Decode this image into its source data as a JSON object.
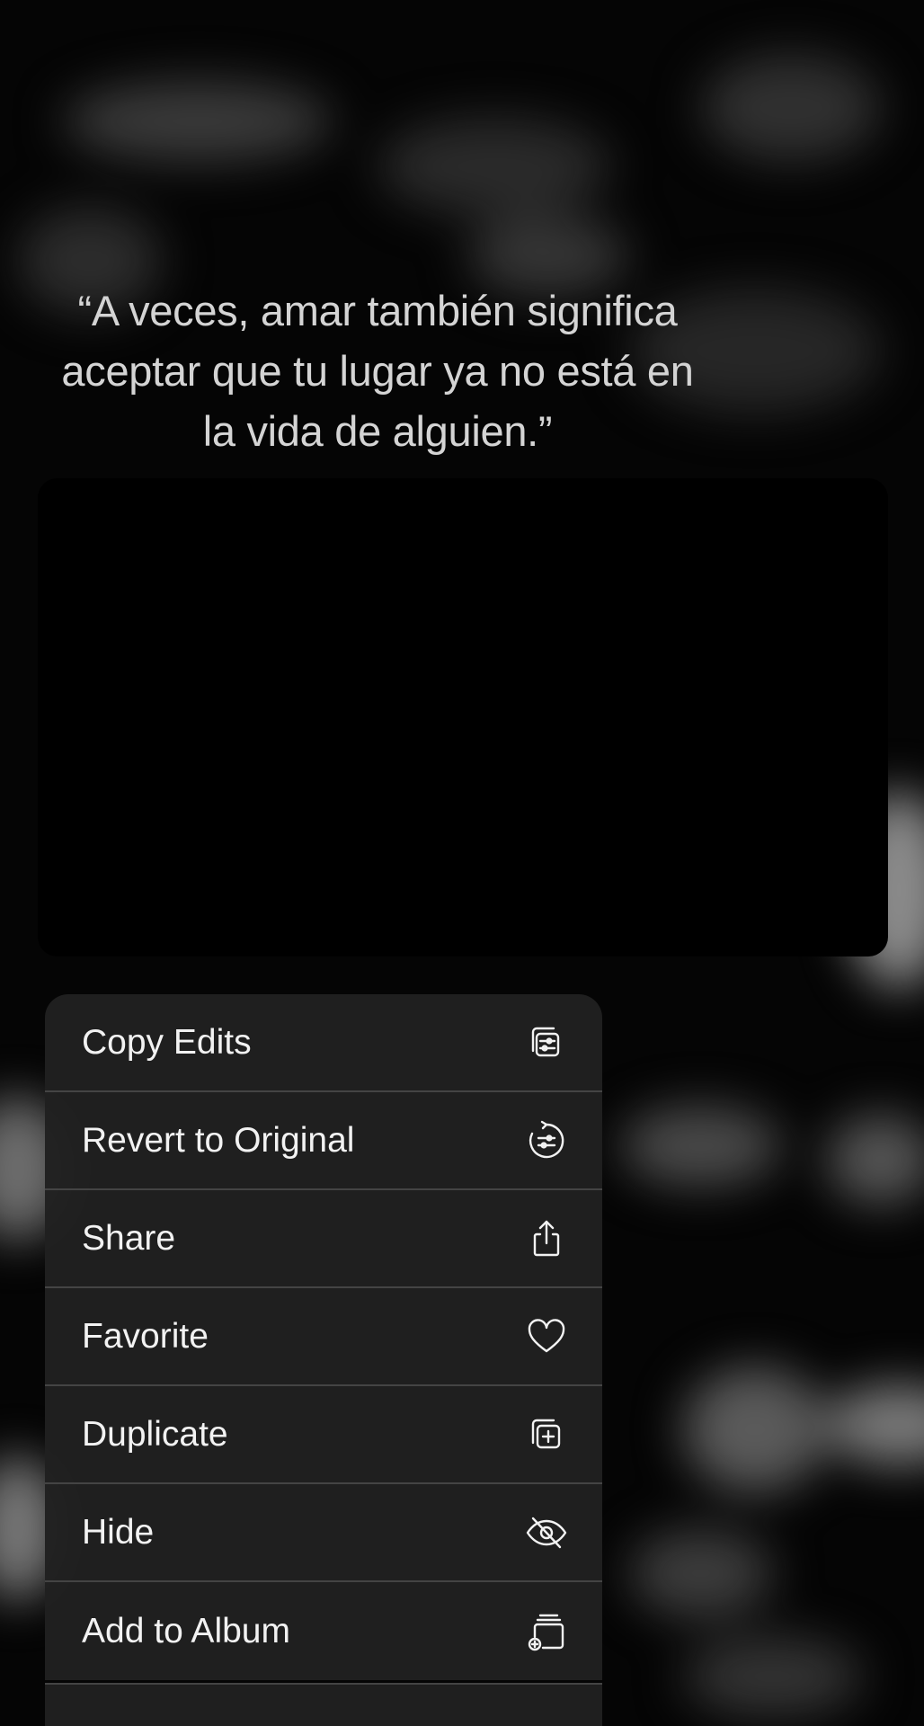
{
  "quote": {
    "line1": "“A veces, amar también significa",
    "line2": "aceptar que tu lugar ya no está en",
    "line3": "la vida de alguien.”"
  },
  "menu": {
    "items": [
      {
        "label": "Copy Edits",
        "icon": "copy-edits-icon"
      },
      {
        "label": "Revert to Original",
        "icon": "revert-icon"
      },
      {
        "label": "Share",
        "icon": "share-icon"
      },
      {
        "label": "Favorite",
        "icon": "heart-icon"
      },
      {
        "label": "Duplicate",
        "icon": "duplicate-icon"
      },
      {
        "label": "Hide",
        "icon": "eye-slash-icon"
      },
      {
        "label": "Add to Album",
        "icon": "add-to-album-icon"
      }
    ]
  },
  "colors": {
    "menu_background": "#202020",
    "menu_text": "#f2f2f2",
    "separator": "#444444",
    "quote_text": "#d4d4d4"
  }
}
